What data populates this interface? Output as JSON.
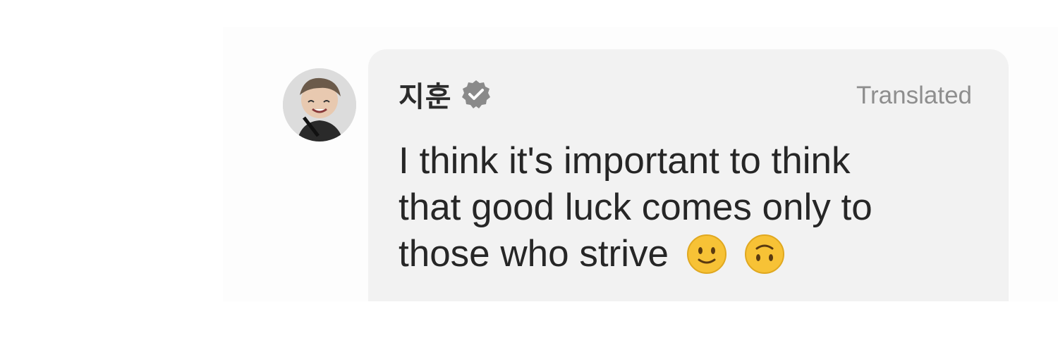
{
  "comment": {
    "username": "지훈",
    "verified_icon": "verified-badge-icon",
    "translated_label": "Translated",
    "message_lines": [
      "I think it's important to think",
      "that good luck comes only to",
      "those who strive"
    ],
    "emojis": [
      "slightly-smiling-face-icon",
      "upside-down-face-icon"
    ]
  },
  "colors": {
    "bubble": "#f2f2f2",
    "text": "#262626",
    "muted": "#8e8e8e",
    "badge": "#8a8a8a",
    "emoji": "#f7c236"
  }
}
